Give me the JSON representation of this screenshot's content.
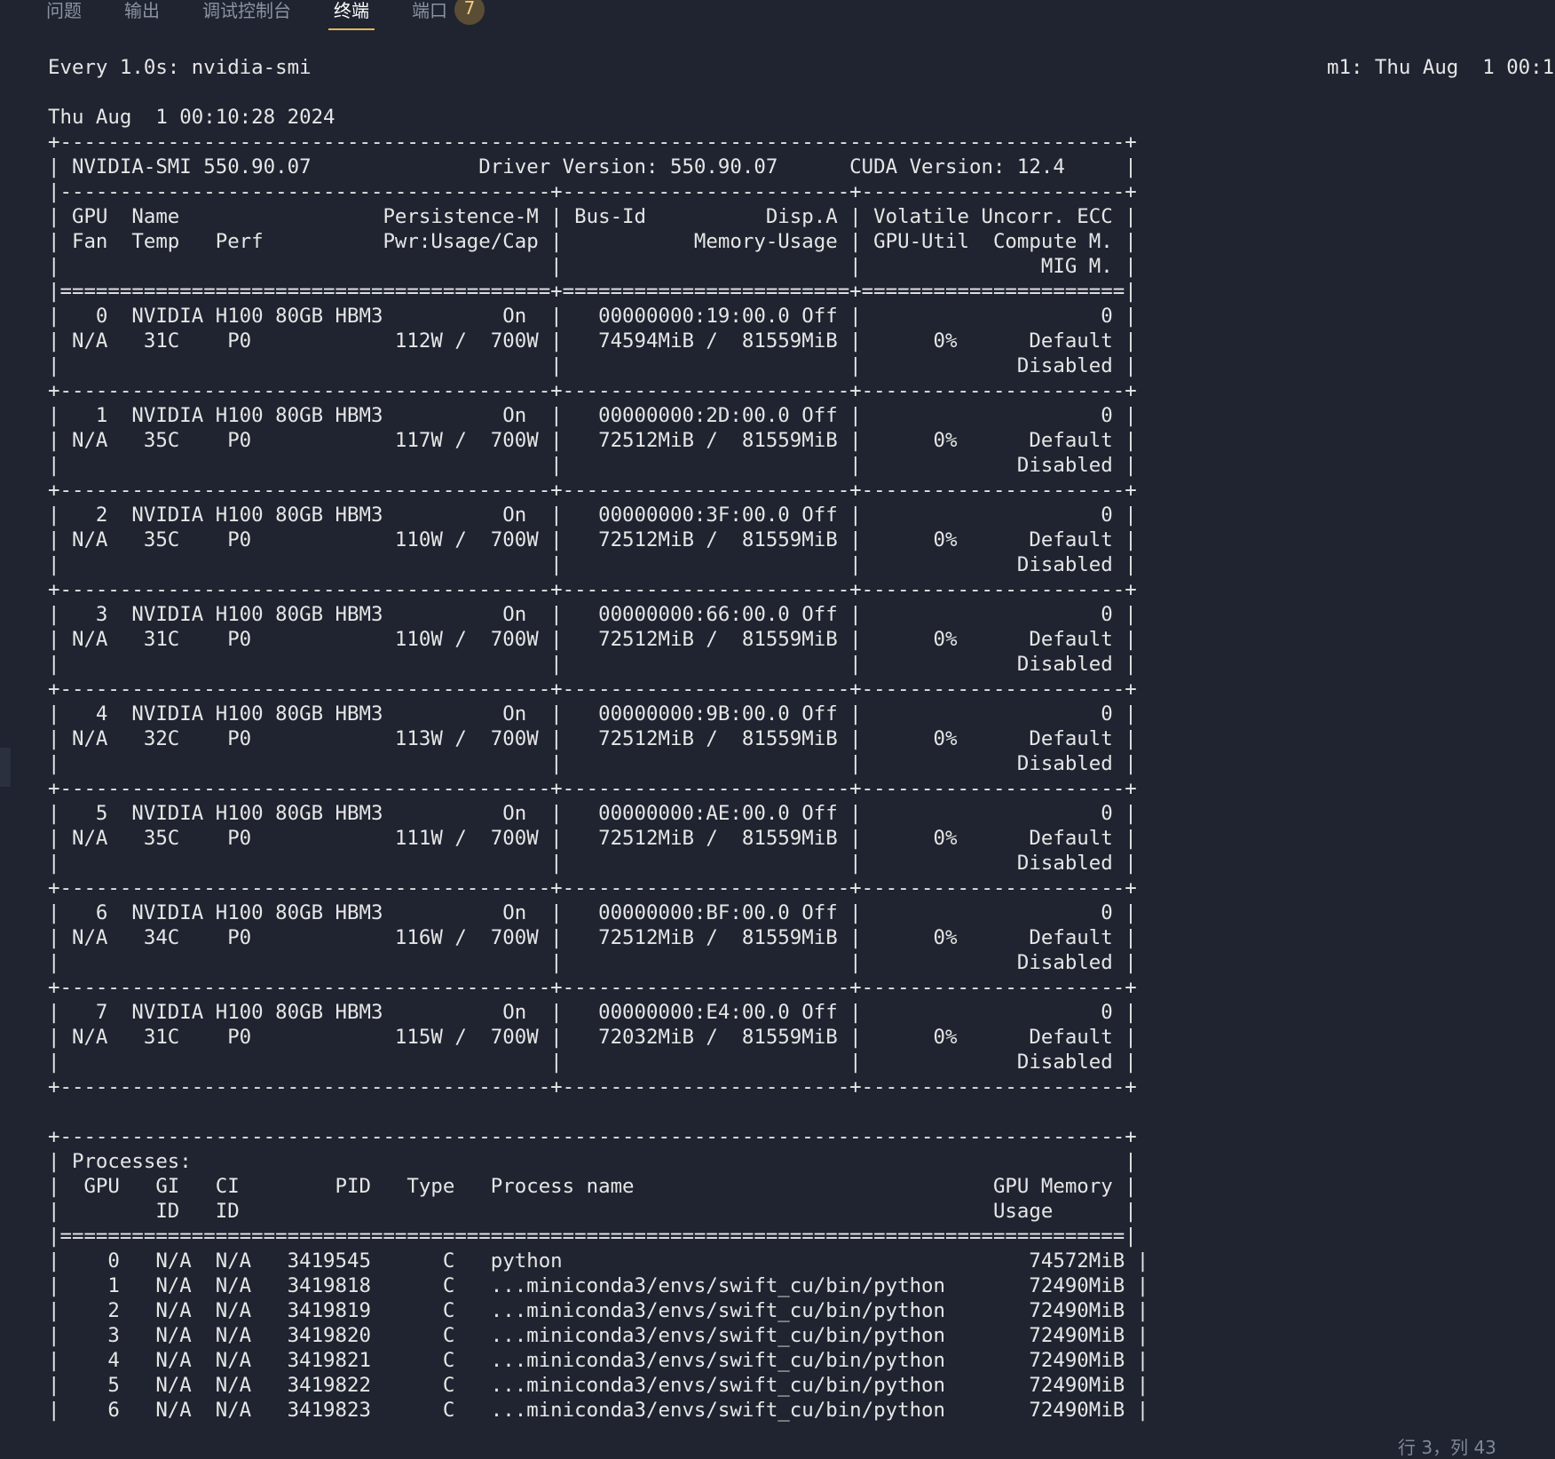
{
  "tabs": [
    {
      "label": "问题",
      "active": false
    },
    {
      "label": "输出",
      "active": false
    },
    {
      "label": "调试控制台",
      "active": false
    },
    {
      "label": "终端",
      "active": true
    },
    {
      "label": "端口",
      "active": false
    }
  ],
  "ports_badge": "7",
  "terminal": {
    "watch_header_left": "Every 1.0s: nvidia-smi",
    "watch_header_right": "m1: Thu Aug  1 00:1",
    "lines": [
      "",
      "Thu Aug  1 00:10:28 2024",
      "+-----------------------------------------------------------------------------------------+",
      "| NVIDIA-SMI 550.90.07              Driver Version: 550.90.07      CUDA Version: 12.4     |",
      "|-----------------------------------------+------------------------+----------------------+",
      "| GPU  Name                 Persistence-M | Bus-Id          Disp.A | Volatile Uncorr. ECC |",
      "| Fan  Temp   Perf          Pwr:Usage/Cap |           Memory-Usage | GPU-Util  Compute M. |",
      "|                                         |                        |               MIG M. |",
      "|=========================================+========================+======================|",
      "|   0  NVIDIA H100 80GB HBM3          On  |   00000000:19:00.0 Off |                    0 |",
      "| N/A   31C    P0            112W /  700W |   74594MiB /  81559MiB |      0%      Default |",
      "|                                         |                        |             Disabled |",
      "+-----------------------------------------+------------------------+----------------------+",
      "|   1  NVIDIA H100 80GB HBM3          On  |   00000000:2D:00.0 Off |                    0 |",
      "| N/A   35C    P0            117W /  700W |   72512MiB /  81559MiB |      0%      Default |",
      "|                                         |                        |             Disabled |",
      "+-----------------------------------------+------------------------+----------------------+",
      "|   2  NVIDIA H100 80GB HBM3          On  |   00000000:3F:00.0 Off |                    0 |",
      "| N/A   35C    P0            110W /  700W |   72512MiB /  81559MiB |      0%      Default |",
      "|                                         |                        |             Disabled |",
      "+-----------------------------------------+------------------------+----------------------+",
      "|   3  NVIDIA H100 80GB HBM3          On  |   00000000:66:00.0 Off |                    0 |",
      "| N/A   31C    P0            110W /  700W |   72512MiB /  81559MiB |      0%      Default |",
      "|                                         |                        |             Disabled |",
      "+-----------------------------------------+------------------------+----------------------+",
      "|   4  NVIDIA H100 80GB HBM3          On  |   00000000:9B:00.0 Off |                    0 |",
      "| N/A   32C    P0            113W /  700W |   72512MiB /  81559MiB |      0%      Default |",
      "|                                         |                        |             Disabled |",
      "+-----------------------------------------+------------------------+----------------------+",
      "|   5  NVIDIA H100 80GB HBM3          On  |   00000000:AE:00.0 Off |                    0 |",
      "| N/A   35C    P0            111W /  700W |   72512MiB /  81559MiB |      0%      Default |",
      "|                                         |                        |             Disabled |",
      "+-----------------------------------------+------------------------+----------------------+",
      "|   6  NVIDIA H100 80GB HBM3          On  |   00000000:BF:00.0 Off |                    0 |",
      "| N/A   34C    P0            116W /  700W |   72512MiB /  81559MiB |      0%      Default |",
      "|                                         |                        |             Disabled |",
      "+-----------------------------------------+------------------------+----------------------+",
      "|   7  NVIDIA H100 80GB HBM3          On  |   00000000:E4:00.0 Off |                    0 |",
      "| N/A   31C    P0            115W /  700W |   72032MiB /  81559MiB |      0%      Default |",
      "|                                         |                        |             Disabled |",
      "+-----------------------------------------+------------------------+----------------------+",
      "",
      "+-----------------------------------------------------------------------------------------+",
      "| Processes:                                                                              |",
      "|  GPU   GI   CI        PID   Type   Process name                              GPU Memory |",
      "|        ID   ID                                                               Usage      |",
      "|=========================================================================================|",
      "|    0   N/A  N/A   3419545      C   python                                       74572MiB |",
      "|    1   N/A  N/A   3419818      C   ...miniconda3/envs/swift_cu/bin/python       72490MiB |",
      "|    2   N/A  N/A   3419819      C   ...miniconda3/envs/swift_cu/bin/python       72490MiB |",
      "|    3   N/A  N/A   3419820      C   ...miniconda3/envs/swift_cu/bin/python       72490MiB |",
      "|    4   N/A  N/A   3419821      C   ...miniconda3/envs/swift_cu/bin/python       72490MiB |",
      "|    5   N/A  N/A   3419822      C   ...miniconda3/envs/swift_cu/bin/python       72490MiB |",
      "|    6   N/A  N/A   3419823      C   ...miniconda3/envs/swift_cu/bin/python       72490MiB |"
    ]
  },
  "statusbar": {
    "cursor_position": "行 3，列 43"
  }
}
